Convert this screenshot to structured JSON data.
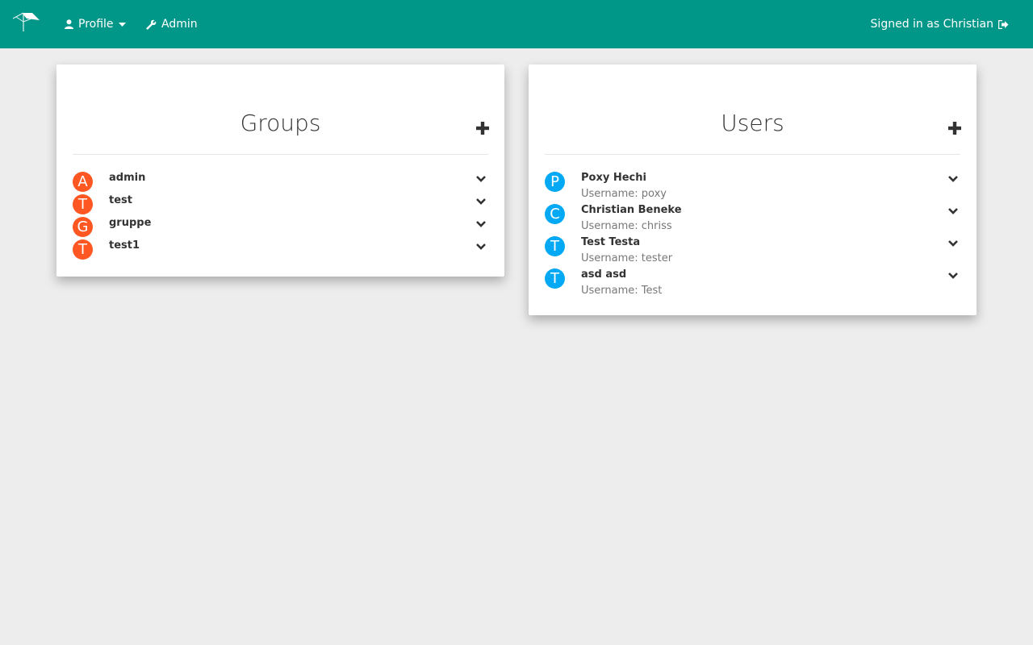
{
  "nav": {
    "profile_label": "Profile",
    "admin_label": "Admin",
    "signed_in_label": "Signed in as Christian",
    "color": "#009688"
  },
  "groups": {
    "title": "Groups",
    "avatar_color": "#ff5722",
    "items": [
      {
        "initial": "A",
        "name": "admin"
      },
      {
        "initial": "T",
        "name": "test"
      },
      {
        "initial": "G",
        "name": "gruppe"
      },
      {
        "initial": "T",
        "name": "test1"
      }
    ]
  },
  "users": {
    "title": "Users",
    "avatar_color": "#03a9f4",
    "items": [
      {
        "initial": "P",
        "name": "Poxy Hechi",
        "username": "Username: poxy"
      },
      {
        "initial": "C",
        "name": "Christian Beneke",
        "username": "Username: chriss"
      },
      {
        "initial": "T",
        "name": "Test Testa",
        "username": "Username: tester"
      },
      {
        "initial": "T",
        "name": "asd asd",
        "username": "Username: Test"
      }
    ]
  }
}
